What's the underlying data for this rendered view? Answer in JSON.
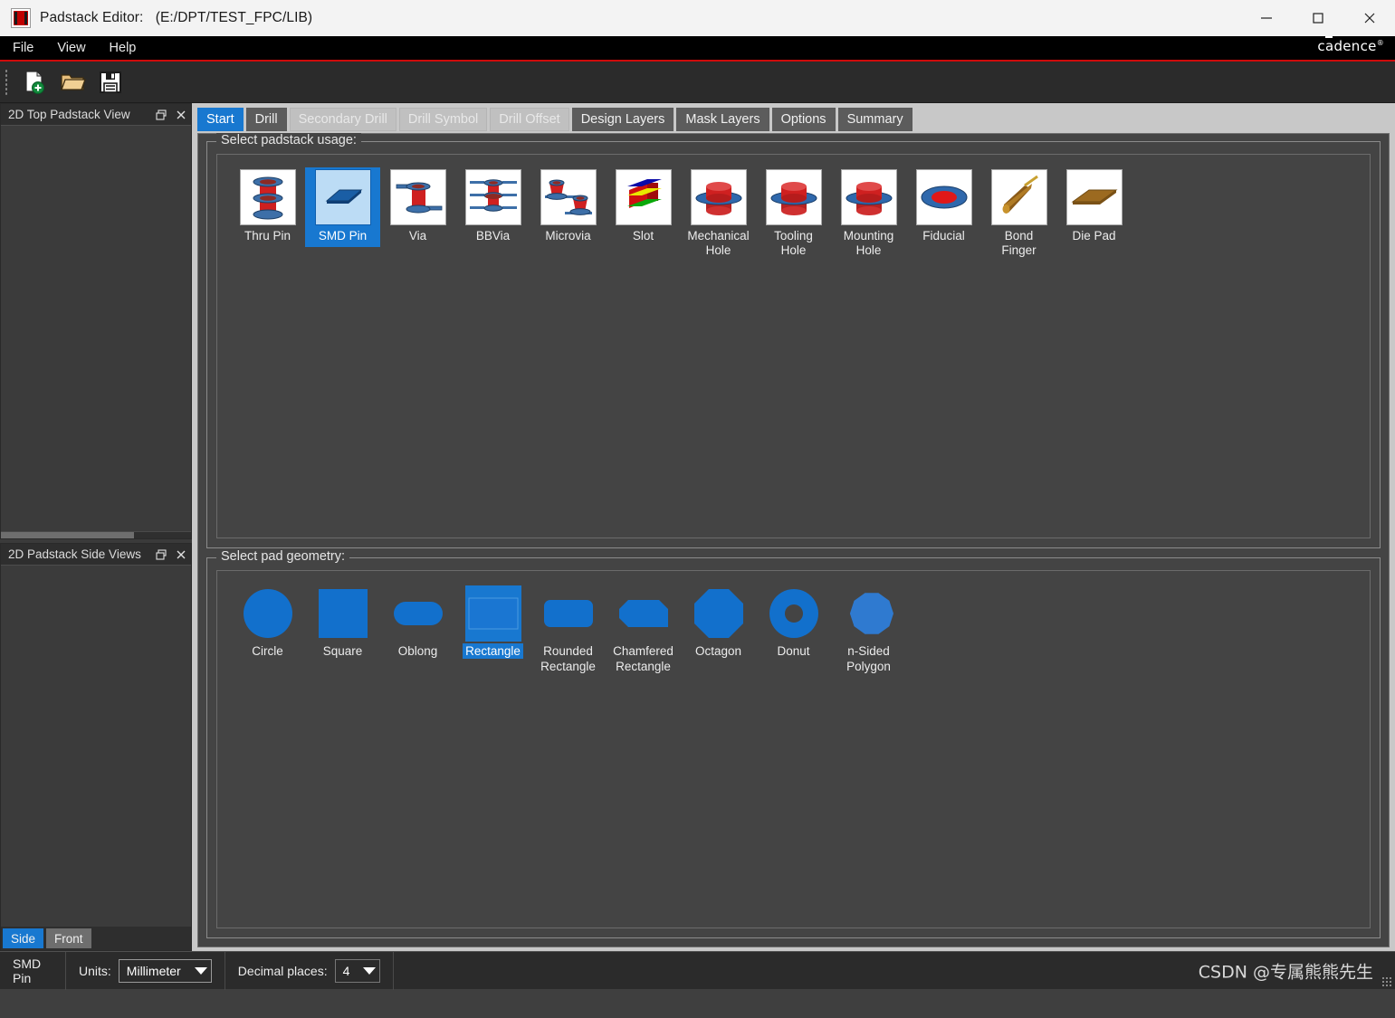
{
  "window": {
    "title": "Padstack Editor:",
    "path": "(E:/DPT/TEST_FPC/LIB)",
    "minimize_label": "—",
    "maximize_label": "☐",
    "close_label": "✕",
    "brand": "cadence",
    "brand_mark": "®"
  },
  "menu": {
    "items": [
      {
        "label": "File"
      },
      {
        "label": "View"
      },
      {
        "label": "Help"
      }
    ]
  },
  "toolbar": {
    "buttons": [
      {
        "name": "new-padstack-button",
        "icon": "new-file-icon"
      },
      {
        "name": "open-padstack-button",
        "icon": "open-folder-icon"
      },
      {
        "name": "save-padstack-button",
        "icon": "save-disk-icon"
      }
    ]
  },
  "docks": {
    "top": {
      "title": "2D Top Padstack View",
      "float_icon": "restore-icon",
      "close_icon": "close-icon"
    },
    "bottom": {
      "title": "2D Padstack Side Views",
      "float_icon": "restore-icon",
      "close_icon": "close-icon",
      "tabs": [
        {
          "label": "Side",
          "active": true
        },
        {
          "label": "Front",
          "active": false
        }
      ]
    }
  },
  "tabs": [
    {
      "label": "Start",
      "state": "active"
    },
    {
      "label": "Drill",
      "state": "dark"
    },
    {
      "label": "Secondary Drill",
      "state": "disabled"
    },
    {
      "label": "Drill Symbol",
      "state": "disabled"
    },
    {
      "label": "Drill Offset",
      "state": "disabled"
    },
    {
      "label": "Design Layers",
      "state": "dark"
    },
    {
      "label": "Mask Layers",
      "state": "dark"
    },
    {
      "label": "Options",
      "state": "dark"
    },
    {
      "label": "Summary",
      "state": "dark"
    }
  ],
  "padstack_usage": {
    "label": "Select padstack usage:",
    "items": [
      {
        "label": "Thru Pin",
        "icon": "thru-pin-icon",
        "selected": false
      },
      {
        "label": "SMD Pin",
        "icon": "smd-pin-icon",
        "selected": true
      },
      {
        "label": "Via",
        "icon": "via-icon",
        "selected": false
      },
      {
        "label": "BBVia",
        "icon": "bbvia-icon",
        "selected": false
      },
      {
        "label": "Microvia",
        "icon": "microvia-icon",
        "selected": false
      },
      {
        "label": "Slot",
        "icon": "slot-icon",
        "selected": false
      },
      {
        "label": "Mechanical\nHole",
        "icon": "mechanical-hole-icon",
        "selected": false
      },
      {
        "label": "Tooling\nHole",
        "icon": "tooling-hole-icon",
        "selected": false
      },
      {
        "label": "Mounting\nHole",
        "icon": "mounting-hole-icon",
        "selected": false
      },
      {
        "label": "Fiducial",
        "icon": "fiducial-icon",
        "selected": false
      },
      {
        "label": "Bond\nFinger",
        "icon": "bond-finger-icon",
        "selected": false
      },
      {
        "label": "Die Pad",
        "icon": "die-pad-icon",
        "selected": false
      }
    ]
  },
  "pad_geometry": {
    "label": "Select pad geometry:",
    "items": [
      {
        "label": "Circle",
        "shape": "circle",
        "selected": false
      },
      {
        "label": "Square",
        "shape": "square",
        "selected": false
      },
      {
        "label": "Oblong",
        "shape": "oblong",
        "selected": false
      },
      {
        "label": "Rectangle",
        "shape": "rectangle",
        "selected": true
      },
      {
        "label": "Rounded\nRectangle",
        "shape": "rounded-rectangle",
        "selected": false
      },
      {
        "label": "Chamfered\nRectangle",
        "shape": "chamfered-rectangle",
        "selected": false
      },
      {
        "label": "Octagon",
        "shape": "octagon",
        "selected": false
      },
      {
        "label": "Donut",
        "shape": "donut",
        "selected": false
      },
      {
        "label": "n-Sided\nPolygon",
        "shape": "n-sided-polygon",
        "selected": false
      }
    ]
  },
  "statusbar": {
    "padstack_type": "SMD Pin",
    "units_label": "Units:",
    "units_value": "Millimeter",
    "decimal_label": "Decimal places:",
    "decimal_value": "4",
    "watermark": "CSDN @专属熊熊先生"
  },
  "colors": {
    "accent": "#1878d0",
    "brand_red": "#cf0a0a",
    "pad_blue": "#1270cc",
    "panel_bg": "#444444",
    "toolbar_bg": "#2b2b2b"
  }
}
